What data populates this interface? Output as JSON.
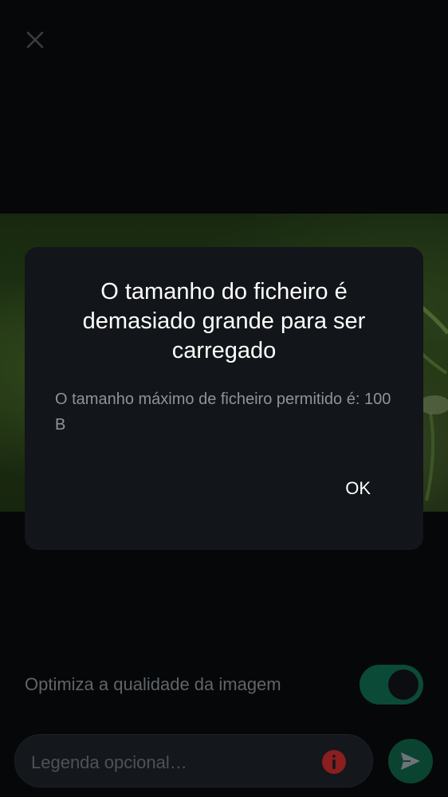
{
  "header": {
    "close_icon": "close-icon"
  },
  "dialog": {
    "title": "O tamanho do ficheiro é demasiado grande para ser carregado",
    "message": "O tamanho máximo de ficheiro permitido é: 100 B",
    "ok_label": "OK"
  },
  "options": {
    "optimize_label": "Optimiza a qualidade da imagem",
    "optimize_enabled": true
  },
  "caption": {
    "placeholder": "Legenda opcional…",
    "value": "",
    "warning_icon": "info-icon",
    "send_icon": "send-icon"
  },
  "colors": {
    "background": "#0b0d10",
    "dialog": "#121519",
    "accent": "#0b4a36",
    "warning": "#8b1e1e"
  }
}
